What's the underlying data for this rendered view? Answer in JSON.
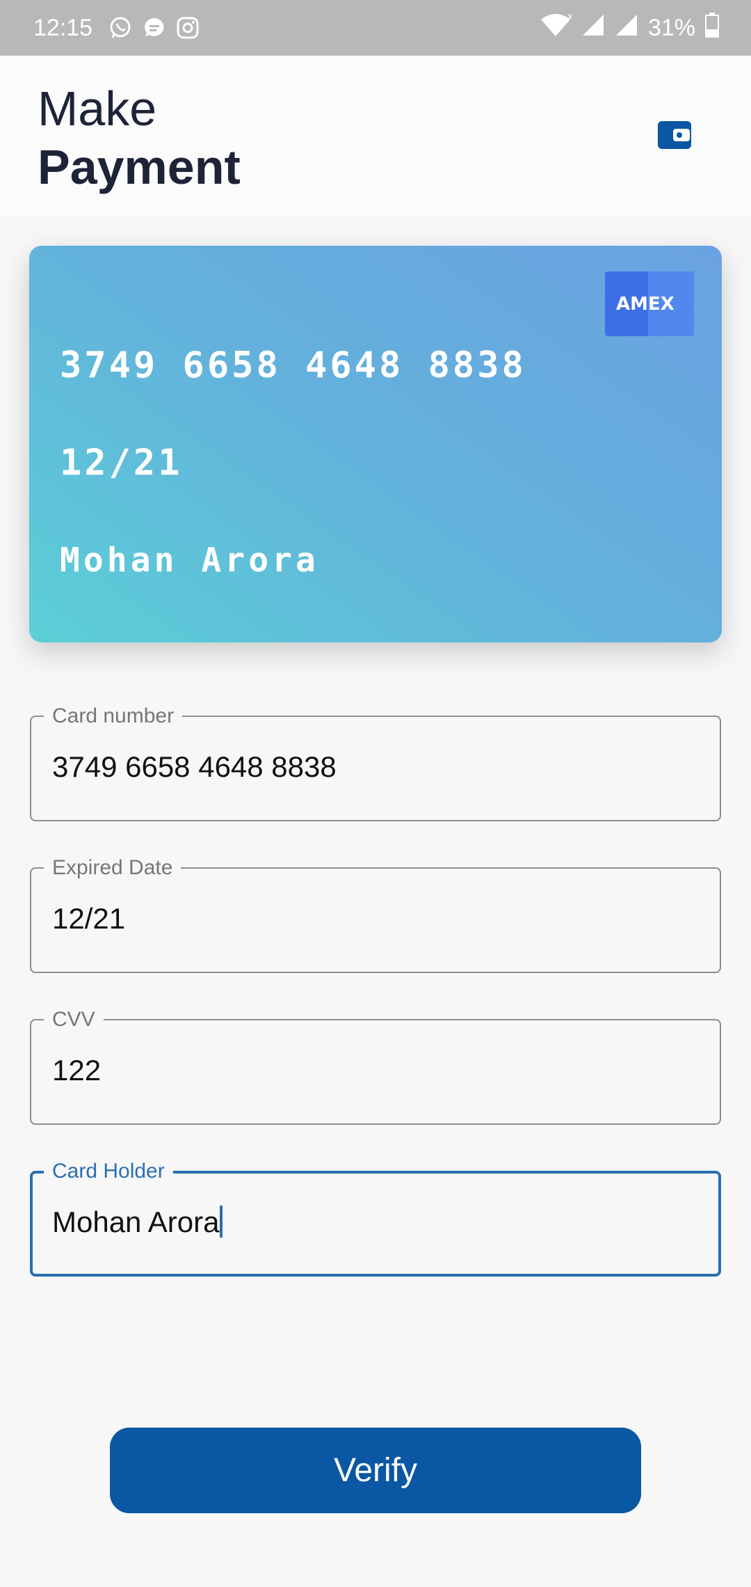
{
  "status_bar": {
    "time": "12:15",
    "battery": "31%",
    "icons": [
      "whatsapp-icon",
      "chat-icon",
      "instagram-icon",
      "wifi-icon",
      "signal-icon",
      "signal-icon",
      "battery-icon"
    ]
  },
  "header": {
    "title_light": "Make",
    "title_bold": "Payment",
    "wallet_icon": "wallet-icon"
  },
  "card": {
    "number": "3749 6658 4648 8838",
    "expiry": "12/21",
    "holder": "Mohan Arora",
    "brand_left": "AM",
    "brand_right": "EX"
  },
  "form": {
    "card_number": {
      "label": "Card number",
      "value": "3749 6658 4648 8838"
    },
    "expiry": {
      "label": "Expired Date",
      "value": "12/21"
    },
    "cvv": {
      "label": "CVV",
      "value": "122"
    },
    "holder": {
      "label": "Card Holder",
      "value": "Mohan Arora"
    }
  },
  "actions": {
    "verify_label": "Verify"
  },
  "colors": {
    "primary": "#0a57a3",
    "focus": "#2a6fb0",
    "title": "#1d2438",
    "card_gradient_start": "#5bcfd6",
    "card_gradient_end": "#6aa2e1"
  }
}
